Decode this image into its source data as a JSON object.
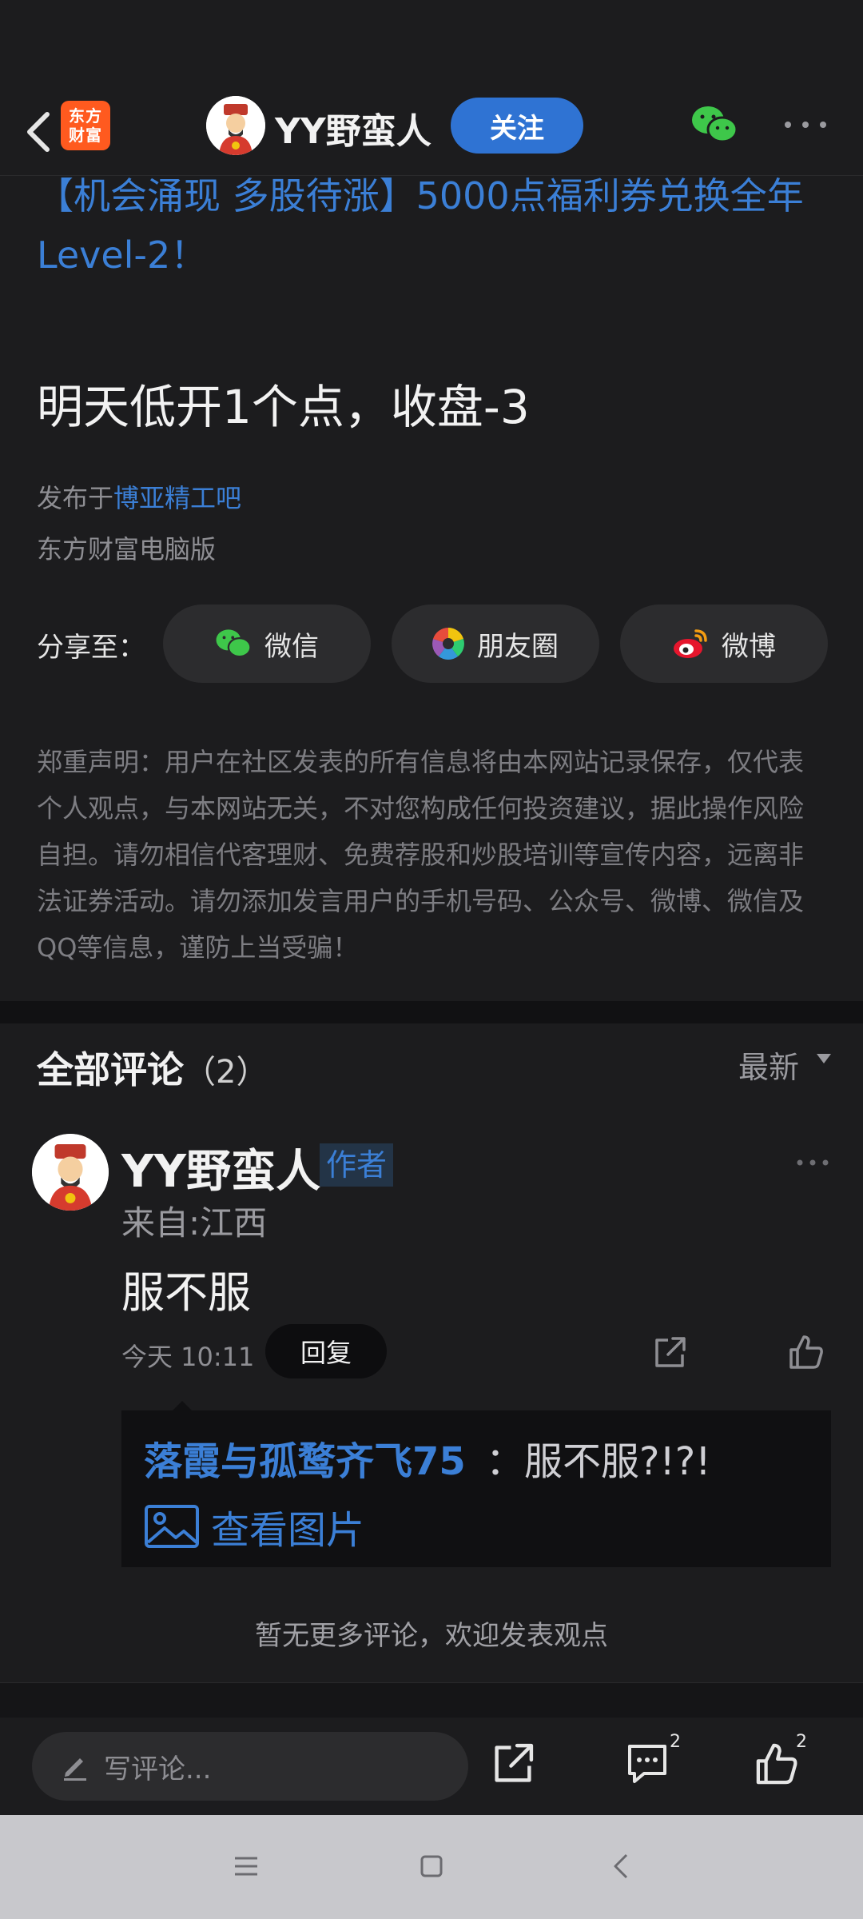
{
  "header": {
    "app_logo_text_line1": "东方",
    "app_logo_text_line2": "财富",
    "username": "YY野蛮人",
    "follow_label": "关注"
  },
  "post": {
    "promo_text": "【机会涌现 多股待涨】5000点福利券兑换全年Level-2！",
    "title": "明天低开1个点，收盘-3",
    "published_prefix": "发布于",
    "forum_name": "博亚精工吧",
    "source": "东方财富电脑版"
  },
  "share": {
    "label": "分享至：",
    "wechat": "微信",
    "moments": "朋友圈",
    "weibo": "微博"
  },
  "disclaimer": "郑重声明：用户在社区发表的所有信息将由本网站记录保存，仅代表个人观点，与本网站无关，不对您构成任何投资建议，据此操作风险自担。请勿相信代客理财、免费荐股和炒股培训等宣传内容，远离非法证券活动。请勿添加发言用户的手机号码、公众号、微博、微信及QQ等信息，谨防上当受骗！",
  "comments": {
    "title": "全部评论",
    "count": "（2）",
    "sort": "最新",
    "items": [
      {
        "username": "YY野蛮人",
        "tag": "作者",
        "location": "来自:江西",
        "text": "服不服",
        "time": "今天 10:11",
        "reply_label": "回复",
        "reply": {
          "username": "落霞与孤鹜齐飞75",
          "text": "：服不服?!?!",
          "view_image": "查看图片"
        }
      }
    ],
    "no_more": "暂无更多评论，欢迎发表观点"
  },
  "action_bar": {
    "write_placeholder": "写评论...",
    "comment_count": "2",
    "like_count": "2"
  },
  "colors": {
    "background": "#1c1c1e",
    "accent_blue": "#3b7fd6",
    "follow_button": "#2f73d3",
    "logo_orange": "#ff5a1f"
  }
}
